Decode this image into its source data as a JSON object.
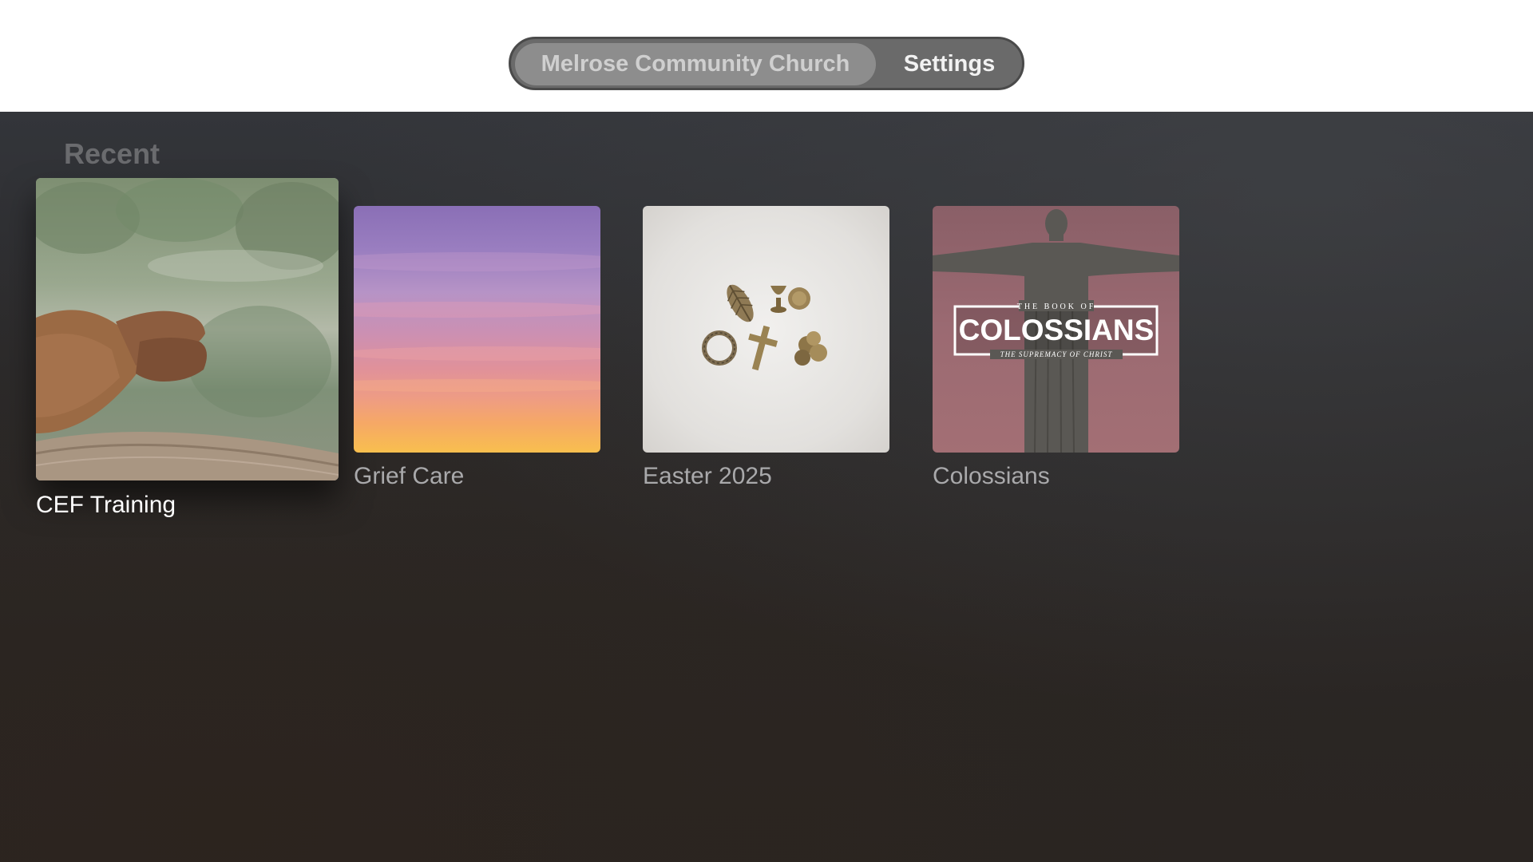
{
  "tabs": {
    "home_label": "Melrose Community Church",
    "settings_label": "Settings"
  },
  "recent": {
    "title": "Recent",
    "items": [
      {
        "title": "CEF Training",
        "artwork": "hands-on-railing-by-lake"
      },
      {
        "title": "Grief Care",
        "artwork": "sunset-sky"
      },
      {
        "title": "Easter 2025",
        "artwork": "easter-symbols"
      },
      {
        "title": "Colossians",
        "artwork": "christ-statue",
        "art_text": {
          "top": "THE BOOK OF",
          "main": "COLOSSIANS",
          "sub": "THE SUPREMACY OF CHRIST"
        }
      }
    ]
  },
  "colors": {
    "background_top": "#ffffff",
    "content_background": "#2c2b2c",
    "tab_bar": "#6a6a6a",
    "tab_selected": "#8d8d8d"
  }
}
